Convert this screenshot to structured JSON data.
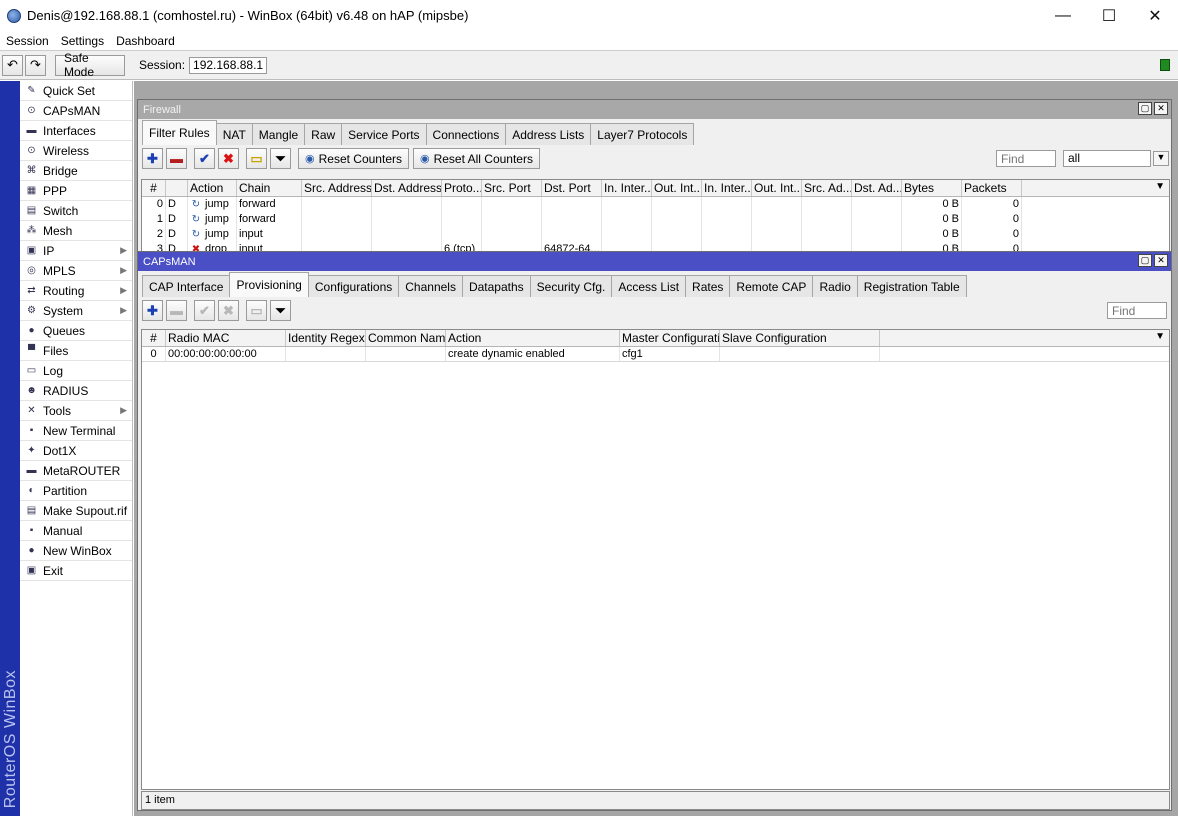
{
  "window": {
    "title": "Denis@192.168.88.1 (comhostel.ru) - WinBox (64bit) v6.48 on hAP (mipsbe)",
    "minimize": "—",
    "maximize": "☐",
    "close": "✕"
  },
  "menu": [
    "Session",
    "Settings",
    "Dashboard"
  ],
  "toolbar": {
    "undo_icon": "↶",
    "redo_icon": "↷",
    "safe_mode_label": "Safe Mode",
    "session_label": "Session:",
    "session_value": "192.168.88.1"
  },
  "brand_text": "RouterOS WinBox",
  "sidebar": [
    {
      "label": "Quick Set",
      "icon": "wand-icon",
      "glyph": "✎",
      "arrow": false
    },
    {
      "label": "CAPsMAN",
      "icon": "antenna-icon",
      "glyph": "⊙",
      "arrow": false
    },
    {
      "label": "Interfaces",
      "icon": "interfaces-icon",
      "glyph": "▬",
      "arrow": false
    },
    {
      "label": "Wireless",
      "icon": "wireless-icon",
      "glyph": "⊙",
      "arrow": false
    },
    {
      "label": "Bridge",
      "icon": "bridge-icon",
      "glyph": "⌘",
      "arrow": false
    },
    {
      "label": "PPP",
      "icon": "ppp-icon",
      "glyph": "▦",
      "arrow": false
    },
    {
      "label": "Switch",
      "icon": "switch-icon",
      "glyph": "▤",
      "arrow": false
    },
    {
      "label": "Mesh",
      "icon": "mesh-icon",
      "glyph": "⁂",
      "arrow": false
    },
    {
      "label": "IP",
      "icon": "ip-icon",
      "glyph": "▣",
      "arrow": true
    },
    {
      "label": "MPLS",
      "icon": "mpls-icon",
      "glyph": "◎",
      "arrow": true
    },
    {
      "label": "Routing",
      "icon": "routing-icon",
      "glyph": "⇄",
      "arrow": true
    },
    {
      "label": "System",
      "icon": "system-icon",
      "glyph": "⚙",
      "arrow": true
    },
    {
      "label": "Queues",
      "icon": "queues-icon",
      "glyph": "●",
      "arrow": false
    },
    {
      "label": "Files",
      "icon": "files-icon",
      "glyph": "▀",
      "arrow": false
    },
    {
      "label": "Log",
      "icon": "log-icon",
      "glyph": "▭",
      "arrow": false
    },
    {
      "label": "RADIUS",
      "icon": "radius-icon",
      "glyph": "☻",
      "arrow": false
    },
    {
      "label": "Tools",
      "icon": "tools-icon",
      "glyph": "✕",
      "arrow": true
    },
    {
      "label": "New Terminal",
      "icon": "terminal-icon",
      "glyph": "▪",
      "arrow": false
    },
    {
      "label": "Dot1X",
      "icon": "dot1x-icon",
      "glyph": "✦",
      "arrow": false
    },
    {
      "label": "MetaROUTER",
      "icon": "metarouter-icon",
      "glyph": "▬",
      "arrow": false
    },
    {
      "label": "Partition",
      "icon": "partition-icon",
      "glyph": "◐",
      "arrow": false
    },
    {
      "label": "Make Supout.rif",
      "icon": "supout-icon",
      "glyph": "▤",
      "arrow": false
    },
    {
      "label": "Manual",
      "icon": "manual-icon",
      "glyph": "▪",
      "arrow": false
    },
    {
      "label": "New WinBox",
      "icon": "winbox-icon",
      "glyph": "●",
      "arrow": false
    },
    {
      "label": "Exit",
      "icon": "exit-icon",
      "glyph": "▣",
      "arrow": false
    }
  ],
  "firewall": {
    "title": "Firewall",
    "tabs": [
      "Filter Rules",
      "NAT",
      "Mangle",
      "Raw",
      "Service Ports",
      "Connections",
      "Address Lists",
      "Layer7 Protocols"
    ],
    "active_tab": 0,
    "reset_counters": "Reset Counters",
    "reset_all_counters": "Reset All Counters",
    "find_placeholder": "Find",
    "filter_value": "all",
    "columns": [
      "#",
      "",
      "Action",
      "Chain",
      "Src. Address",
      "Dst. Address",
      "Proto...",
      "Src. Port",
      "Dst. Port",
      "In. Inter...",
      "Out. Int...",
      "In. Inter...",
      "Out. Int...",
      "Src. Ad...",
      "Dst. Ad...",
      "Bytes",
      "Packets"
    ],
    "rows": [
      {
        "num": "0",
        "flag": "D",
        "action": "jump",
        "chain": "forward",
        "proto": "",
        "dst_port": "",
        "bytes": "0 B",
        "packets": "0"
      },
      {
        "num": "1",
        "flag": "D",
        "action": "jump",
        "chain": "forward",
        "proto": "",
        "dst_port": "",
        "bytes": "0 B",
        "packets": "0"
      },
      {
        "num": "2",
        "flag": "D",
        "action": "jump",
        "chain": "input",
        "proto": "",
        "dst_port": "",
        "bytes": "0 B",
        "packets": "0"
      },
      {
        "num": "3",
        "flag": "D",
        "action": "drop",
        "chain": "input",
        "proto": "6 (tcp)",
        "dst_port": "64872-64...",
        "bytes": "0 B",
        "packets": "0"
      }
    ]
  },
  "capsman": {
    "title": "CAPsMAN",
    "tabs": [
      "CAP Interface",
      "Provisioning",
      "Configurations",
      "Channels",
      "Datapaths",
      "Security Cfg.",
      "Access List",
      "Rates",
      "Remote CAP",
      "Radio",
      "Registration Table"
    ],
    "active_tab": 1,
    "find_placeholder": "Find",
    "columns": [
      "#",
      "Radio MAC",
      "Identity Regexp",
      "Common Nam...",
      "Action",
      "Master Configurati...",
      "Slave Configuration"
    ],
    "rows": [
      {
        "num": "0",
        "radio_mac": "00:00:00:00:00:00",
        "identity": "",
        "common": "",
        "action": "create dynamic enabled",
        "master": "cfg1",
        "slave": ""
      }
    ],
    "status": "1 item"
  },
  "colors": {
    "active_title": "#4b4fc6",
    "brand_strip": "#1f31a8",
    "status_led": "#1f8a1f"
  }
}
